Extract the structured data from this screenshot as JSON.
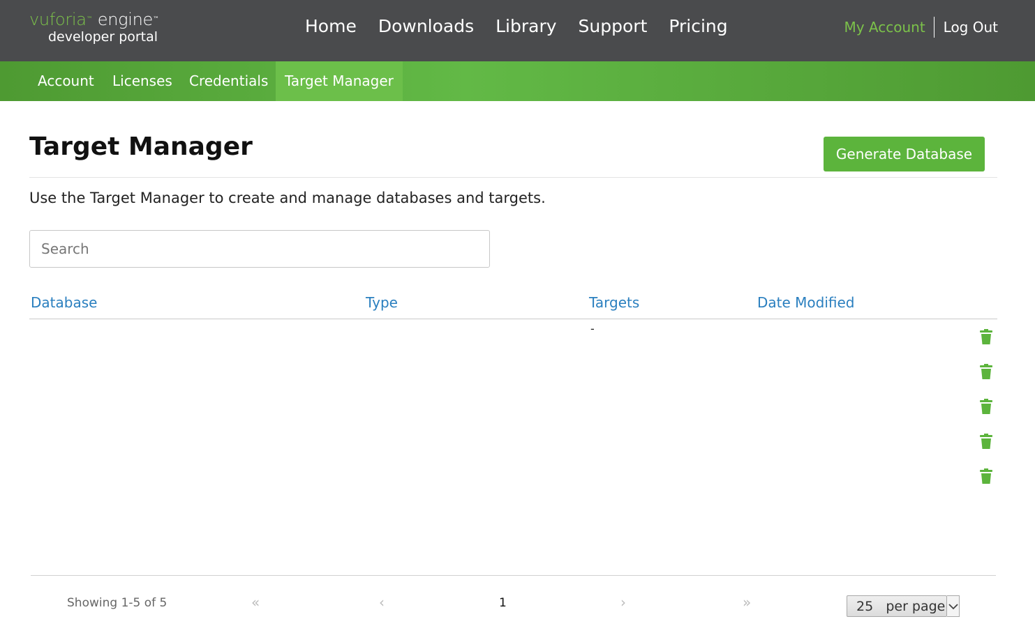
{
  "logo": {
    "brand": "vuforia",
    "product": "engine",
    "trademark": "™",
    "subtitle": "developer portal"
  },
  "main_nav": {
    "items": [
      "Home",
      "Downloads",
      "Library",
      "Support",
      "Pricing"
    ]
  },
  "account_nav": {
    "my_account": "My Account",
    "log_out": "Log Out"
  },
  "sub_nav": {
    "items": [
      "Account",
      "Licenses",
      "Credentials",
      "Target Manager"
    ],
    "active": "Target Manager"
  },
  "page": {
    "title": "Target Manager",
    "generate_button": "Generate Database",
    "description": "Use the Target Manager to create and manage databases and targets.",
    "search_placeholder": "Search"
  },
  "table": {
    "columns": [
      "Database",
      "Type",
      "Targets",
      "Date Modified"
    ],
    "rows": [
      {
        "database": "",
        "type": "",
        "targets": "-",
        "date_modified": ""
      },
      {
        "database": "",
        "type": "",
        "targets": "",
        "date_modified": ""
      },
      {
        "database": "",
        "type": "",
        "targets": "",
        "date_modified": ""
      },
      {
        "database": "",
        "type": "",
        "targets": "",
        "date_modified": ""
      },
      {
        "database": "",
        "type": "",
        "targets": "",
        "date_modified": ""
      }
    ],
    "row_action_icon": "trash-icon"
  },
  "pagination": {
    "showing": "Showing 1-5 of 5",
    "first": "«",
    "prev": "‹",
    "current_page": "1",
    "next": "›",
    "last": "»",
    "per_page_value": "25",
    "per_page_label": "per page"
  },
  "colors": {
    "topbar": "#4a4b4d",
    "brand_green": "#7cc24a",
    "subnav_green": "#5cb43c",
    "link_blue": "#2a7fbf",
    "trash_green": "#5cb43c"
  }
}
